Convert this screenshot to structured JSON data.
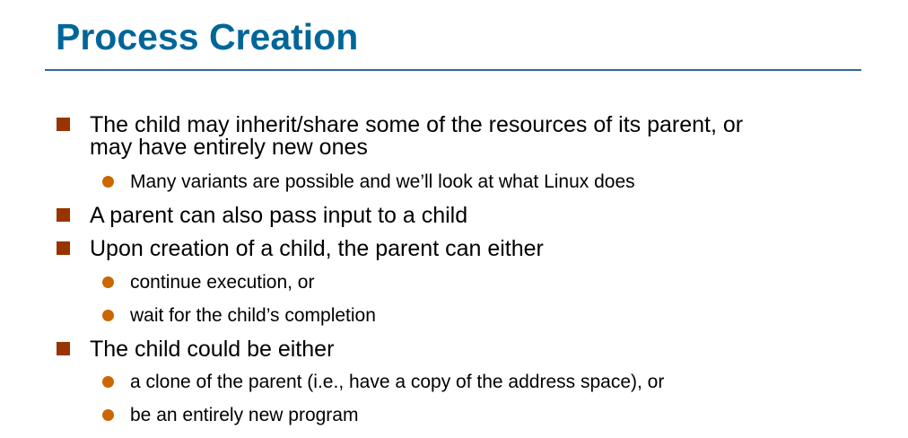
{
  "title": "Process Creation",
  "colors": {
    "title": "#006699",
    "rule": "#336699",
    "bullet1": "#993300",
    "bullet2": "#cc6600"
  },
  "bullets": [
    {
      "text": "The child may inherit/share some of the resources of its parent, or",
      "text2": "may have entirely new ones"
    },
    {
      "text": "Many variants are possible and we’ll look at what Linux does"
    },
    {
      "text": "A parent can also pass input to a child"
    },
    {
      "text": "Upon creation of a child, the parent can either"
    },
    {
      "text": "continue execution, or"
    },
    {
      "text": "wait for the child’s completion"
    },
    {
      "text": "The child could be either"
    },
    {
      "text": "a clone of the parent (i.e., have a copy of the address space), or"
    },
    {
      "text": "be an entirely new program"
    }
  ]
}
